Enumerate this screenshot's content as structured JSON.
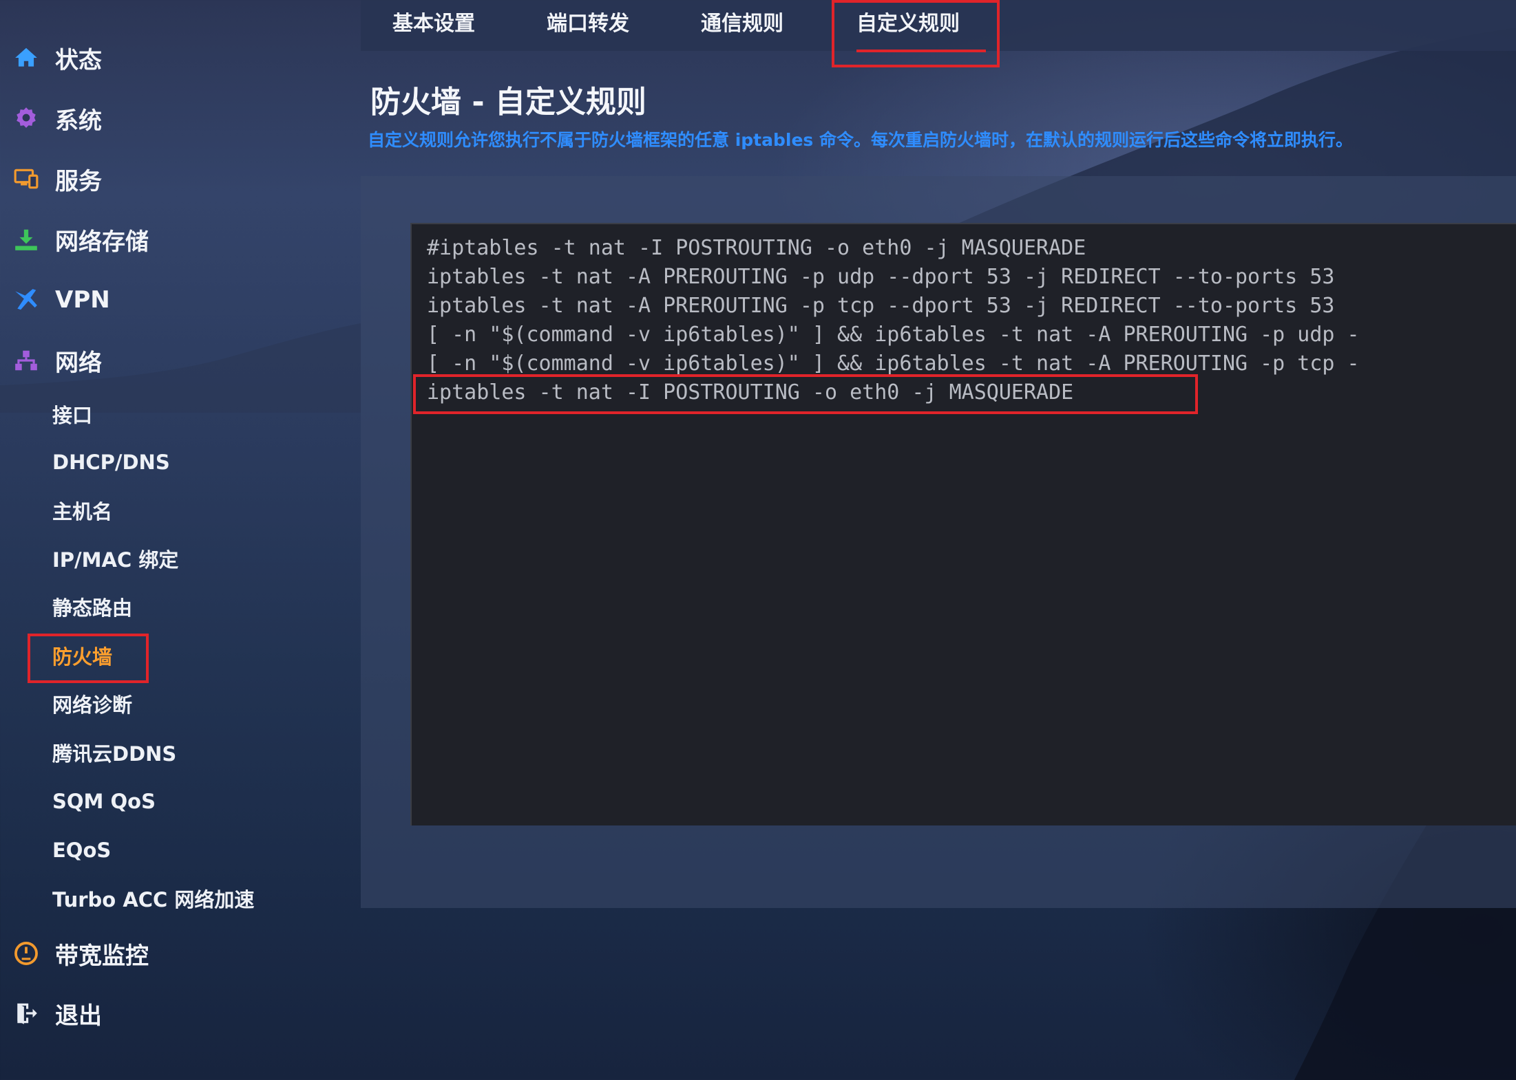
{
  "sidebar": {
    "top_items": [
      {
        "label": "状态",
        "icon": "home-icon"
      },
      {
        "label": "系统",
        "icon": "gear-icon"
      },
      {
        "label": "服务",
        "icon": "services-icon"
      },
      {
        "label": "网络存储",
        "icon": "download-icon"
      },
      {
        "label": "VPN",
        "icon": "plane-icon"
      },
      {
        "label": "网络",
        "icon": "network-icon"
      }
    ],
    "network_sub_items": [
      {
        "label": "接口"
      },
      {
        "label": "DHCP/DNS"
      },
      {
        "label": "主机名"
      },
      {
        "label": "IP/MAC 绑定"
      },
      {
        "label": "静态路由"
      },
      {
        "label": "防火墙",
        "active": true
      },
      {
        "label": "网络诊断"
      },
      {
        "label": "腾讯云DDNS"
      },
      {
        "label": "SQM QoS"
      },
      {
        "label": "EQoS"
      },
      {
        "label": "Turbo ACC 网络加速"
      }
    ],
    "bottom_items": [
      {
        "label": "带宽监控",
        "icon": "gauge-icon"
      },
      {
        "label": "退出",
        "icon": "logout-icon"
      }
    ]
  },
  "tabs": [
    {
      "label": "基本设置"
    },
    {
      "label": "端口转发"
    },
    {
      "label": "通信规则"
    },
    {
      "label": "自定义规则",
      "active": true
    }
  ],
  "page": {
    "title": "防火墙 - 自定义规则",
    "description": "自定义规则允许您执行不属于防火墙框架的任意 iptables 命令。每次重启防火墙时，在默认的规则运行后这些命令将立即执行。"
  },
  "editor": {
    "lines": [
      "#iptables -t nat -I POSTROUTING -o eth0 -j MASQUERADE",
      "iptables -t nat -A PREROUTING -p udp --dport 53 -j REDIRECT --to-ports 53",
      "iptables -t nat -A PREROUTING -p tcp --dport 53 -j REDIRECT --to-ports 53",
      "[ -n \"$(command -v ip6tables)\" ] && ip6tables -t nat -A PREROUTING -p udp -",
      "[ -n \"$(command -v ip6tables)\" ] && ip6tables -t nat -A PREROUTING -p tcp -",
      "iptables -t nat -I POSTROUTING -o eth0 -j MASQUERADE"
    ]
  },
  "colors": {
    "accent_blue": "#2f8dff",
    "active_orange": "#ff9f2e",
    "highlight_red": "#e0242a"
  }
}
